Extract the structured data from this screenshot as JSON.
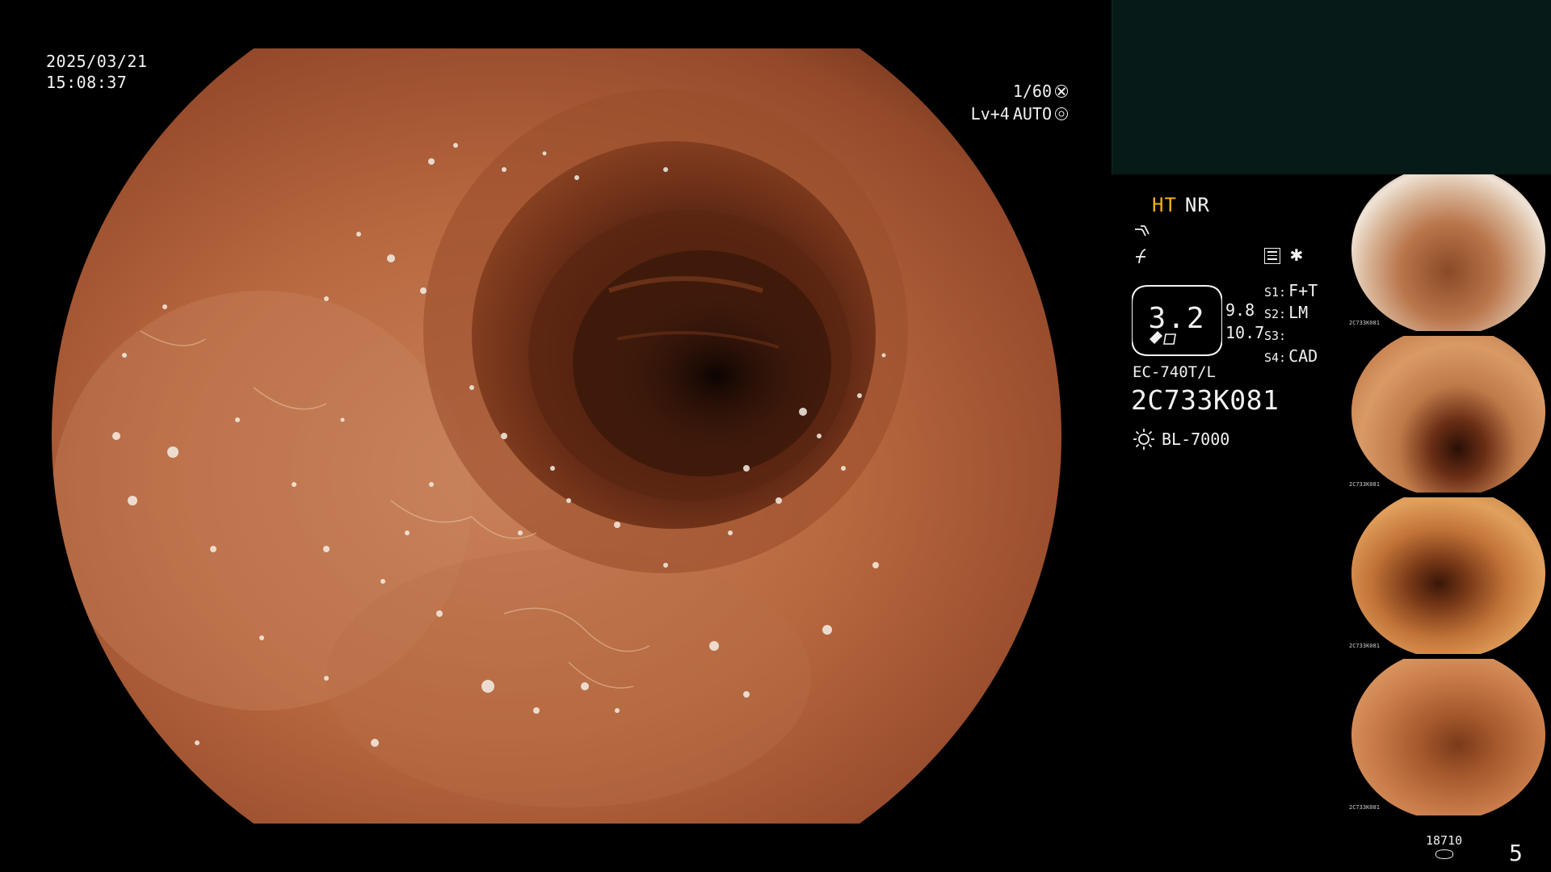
{
  "overlay": {
    "date": "2025/03/21",
    "time": "15:08:37",
    "shutter": "1/60",
    "level": "Lv+4",
    "iris_mode": "AUTO"
  },
  "panel": {
    "ht_label": "HT",
    "nr_label": "NR",
    "zoom_value": "3.2",
    "zoom_sub_1": "9.8",
    "zoom_sub_2": "10.7",
    "switches": [
      {
        "key": "S1:",
        "value": "F+T"
      },
      {
        "key": "S2:",
        "value": "LM"
      },
      {
        "key": "S3:",
        "value": ""
      },
      {
        "key": "S4:",
        "value": "CAD"
      }
    ],
    "scope_model": "EC-740T/L",
    "scope_serial": "2C733K081",
    "light_source": "BL-7000"
  },
  "thumbnails": [
    {
      "caption": "2C733K081"
    },
    {
      "caption": "2C733K081"
    },
    {
      "caption": "2C733K081"
    },
    {
      "caption": "2C733K081"
    }
  ],
  "footer": {
    "capture_count": "18710",
    "page_number": "5"
  },
  "colors": {
    "ht_accent": "#f0b21a",
    "panel_teal": "#061b18",
    "mucosa": "#b8673f"
  }
}
